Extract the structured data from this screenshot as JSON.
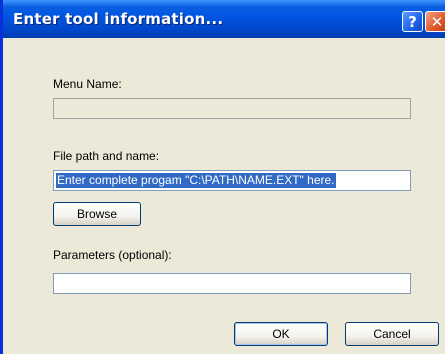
{
  "window": {
    "title": "Enter tool information...",
    "help_glyph": "?",
    "close_glyph": "✕"
  },
  "form": {
    "menu_name_label": "Menu Name:",
    "menu_name_value": "",
    "file_path_label": "File path and name:",
    "file_path_value": "Enter complete progam \"C:\\PATH\\NAME.EXT\" here.",
    "browse": {
      "mnemonic": "B",
      "rest": "rowse"
    },
    "parameters_label": "Parameters (optional):",
    "parameters_value": ""
  },
  "buttons": {
    "ok": {
      "mnemonic": "O",
      "rest": "K"
    },
    "cancel": {
      "mnemonic": "C",
      "rest": "ancel"
    }
  },
  "colors": {
    "titlebar": "#0054e3",
    "selection": "#316ac5",
    "dialog_bg": "#ece9d8"
  }
}
